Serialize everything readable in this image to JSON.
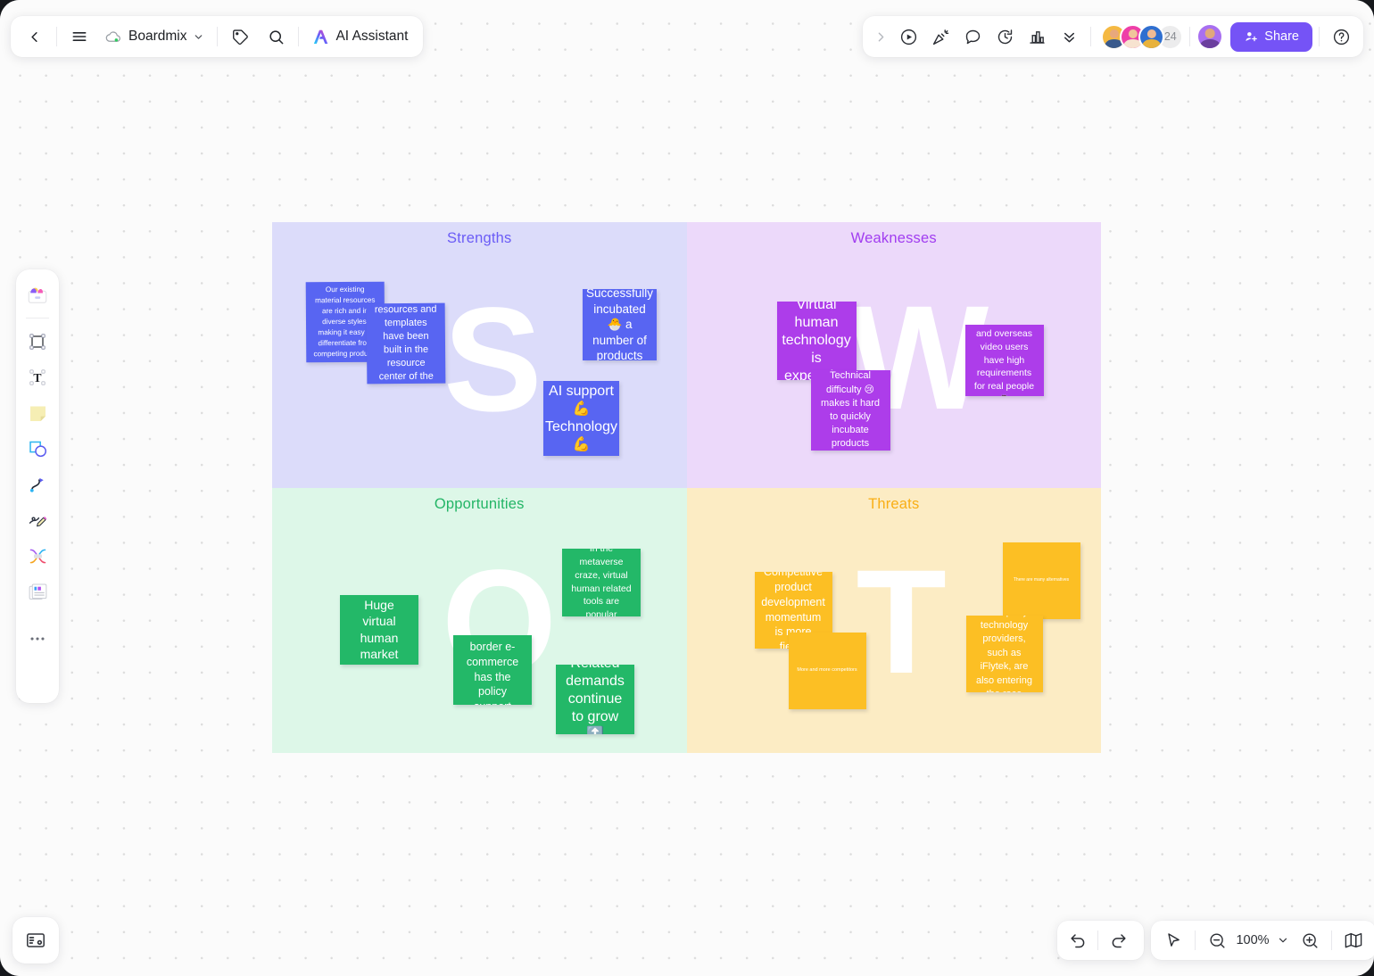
{
  "app": {
    "doc_title": "Boardmix",
    "ai_assistant_label": "AI Assistant"
  },
  "topbar": {
    "back_icon": "chevron-left-icon",
    "menu_icon": "hamburger-menu-icon",
    "cloud_icon": "cloud-saved-icon",
    "chevron_icon": "chevron-down-icon",
    "tag_icon": "tag-icon",
    "search_icon": "search-icon",
    "ai_icon": "ai-sparkle-icon"
  },
  "topright": {
    "expand_icon": "chevron-right-icon",
    "present_icon": "play-circle-icon",
    "celebrate_icon": "party-popper-icon",
    "comment_icon": "comment-bubble-icon",
    "timer_icon": "timer-icon",
    "chart_icon": "bar-chart-icon",
    "collapse_icon": "double-chevron-down-icon",
    "collaborator_count": "24",
    "share_label": "Share",
    "share_icon": "add-person-icon",
    "help_icon": "help-circle-icon",
    "share_color": "#7553f6"
  },
  "toolrail": {
    "items": [
      {
        "name": "templates-icon",
        "label": "Templates"
      },
      {
        "name": "frame-icon",
        "label": "Frame"
      },
      {
        "name": "text-icon",
        "label": "Text"
      },
      {
        "name": "sticky-note-icon",
        "label": "Sticky note"
      },
      {
        "name": "shapes-icon",
        "label": "Shapes"
      },
      {
        "name": "connector-line-icon",
        "label": "Connector"
      },
      {
        "name": "pen-icon",
        "label": "Pen"
      },
      {
        "name": "mindmap-icon",
        "label": "Mind map"
      },
      {
        "name": "document-icon",
        "label": "Document"
      },
      {
        "name": "more-options-icon",
        "label": "More"
      }
    ]
  },
  "bottombar": {
    "settings_icon": "board-settings-icon",
    "undo_icon": "undo-arrow-icon",
    "redo_icon": "redo-arrow-icon",
    "cursor_icon": "cursor-pointer-icon",
    "zoom_out_icon": "zoom-out-icon",
    "zoom_level": "100%",
    "zoom_chevron_icon": "chevron-down-icon",
    "zoom_in_icon": "zoom-in-icon",
    "minimap_icon": "minimap-icon"
  },
  "board": {
    "quadrants": [
      {
        "key": "strengths",
        "title": "Strengths",
        "title_color": "#6b5cf6",
        "bg": "#dcdcfa",
        "watermark": "S",
        "note_color": "#5865f2"
      },
      {
        "key": "weaknesses",
        "title": "Weaknesses",
        "title_color": "#a13df0",
        "bg": "#ecd9fa",
        "watermark": "W",
        "note_color": "#ad3dea"
      },
      {
        "key": "opportunities",
        "title": "Opportunities",
        "title_color": "#23b566",
        "bg": "#ddf7e8",
        "watermark": "O",
        "note_color": "#23b868"
      },
      {
        "key": "threats",
        "title": "Threats",
        "title_color": "#f9ae14",
        "bg": "#fcecc4",
        "watermark": "T",
        "note_color": "#fcbf24"
      }
    ],
    "notes": {
      "strengths": [
        {
          "text": "Our existing material resources are rich and in diverse styles, making it easy to differentiate from competing products",
          "font": 8.2
        },
        {
          "text": "Virtual human resources and templates have been built in the resource center of the company",
          "font": 11
        },
        {
          "text": "Successfully incubated 🐣 a number of products",
          "font": 13.5
        },
        {
          "text": "AI support 💪Technology💪",
          "font": 16
        }
      ],
      "weaknesses": [
        {
          "text": "Virtual human technology is expensive",
          "font": 16
        },
        {
          "text": "Technical difficulty 😢 makes it hard to quickly incubate products",
          "font": 11
        },
        {
          "text": "Advertisers and overseas video users have high requirements for real people 🙇",
          "font": 10.5
        }
      ],
      "opportunities": [
        {
          "text": "Huge virtual human market",
          "font": 14
        },
        {
          "text": "Cross-border e-commerce has the policy support",
          "font": 12.5
        },
        {
          "text": "In the metaverse craze, virtual human related tools are popular",
          "font": 10.5
        },
        {
          "text": "Related demands continue to grow 🔝",
          "font": 16
        }
      ],
      "threats": [
        {
          "text": "Competitive product development momentum is more fierce",
          "font": 12.5
        },
        {
          "text": "More and more competitors",
          "font": 5.5
        },
        {
          "text": "There are many alternatives",
          "font": 5
        },
        {
          "text": "Third-party technology providers, such as iFlytek, are also entering the race",
          "font": 11
        }
      ]
    }
  }
}
